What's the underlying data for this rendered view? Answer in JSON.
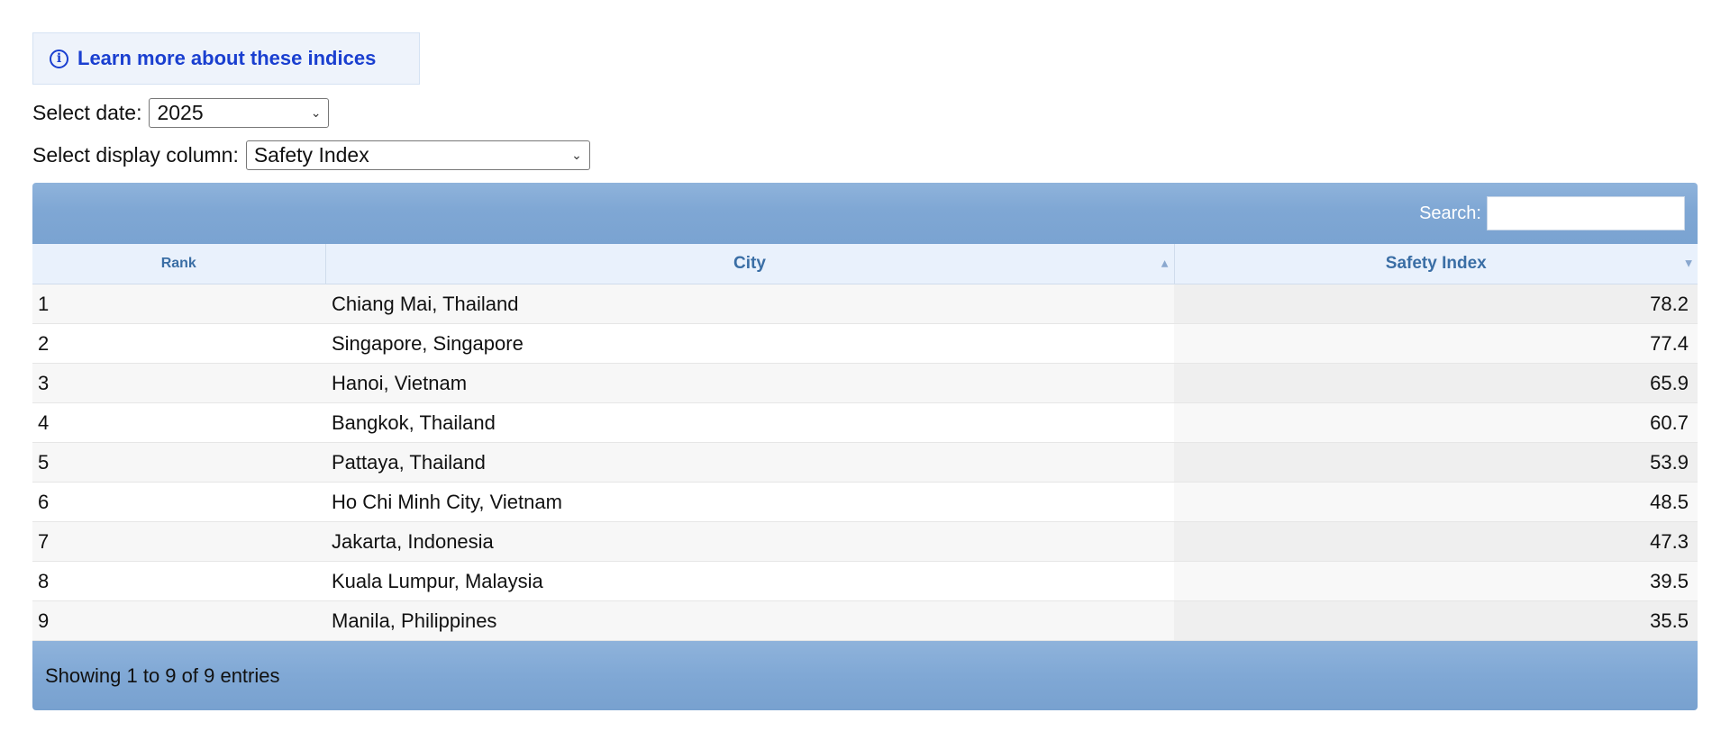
{
  "info": {
    "icon": "info-icon",
    "link_text": "Learn more about these indices"
  },
  "filters": {
    "date_label": "Select date:",
    "date_value": "2025",
    "column_label": "Select display column:",
    "column_value": "Safety Index"
  },
  "table": {
    "search_label": "Search:",
    "search_value": "",
    "columns": [
      "Rank",
      "City",
      "Safety Index"
    ],
    "rows": [
      {
        "rank": "1",
        "city": "Chiang Mai, Thailand",
        "value": "78.2"
      },
      {
        "rank": "2",
        "city": "Singapore, Singapore",
        "value": "77.4"
      },
      {
        "rank": "3",
        "city": "Hanoi, Vietnam",
        "value": "65.9"
      },
      {
        "rank": "4",
        "city": "Bangkok, Thailand",
        "value": "60.7"
      },
      {
        "rank": "5",
        "city": "Pattaya, Thailand",
        "value": "53.9"
      },
      {
        "rank": "6",
        "city": "Ho Chi Minh City, Vietnam",
        "value": "48.5"
      },
      {
        "rank": "7",
        "city": "Jakarta, Indonesia",
        "value": "47.3"
      },
      {
        "rank": "8",
        "city": "Kuala Lumpur, Malaysia",
        "value": "39.5"
      },
      {
        "rank": "9",
        "city": "Manila, Philippines",
        "value": "35.5"
      }
    ],
    "footer": "Showing 1 to 9 of 9 entries"
  },
  "colors": {
    "link": "#1a3fd0",
    "header_text": "#3a6ea5",
    "bar": "#7fa7d4"
  }
}
